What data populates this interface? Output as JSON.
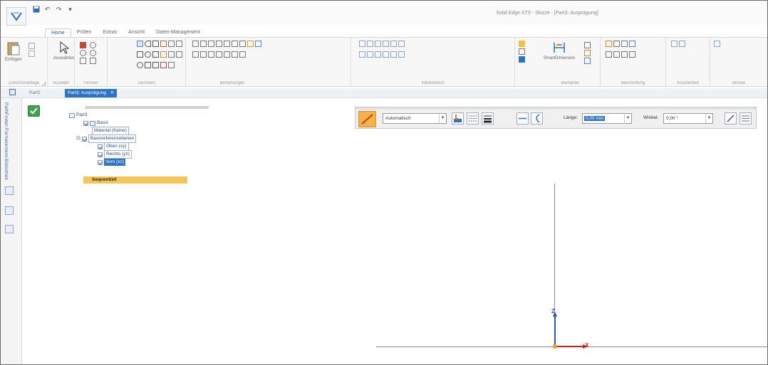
{
  "window": {
    "title": "Solid Edge ST9 - Skizze - [Part3: Ausprägung]"
  },
  "quick_access": {
    "icons": [
      "app-logo-icon",
      "save-icon",
      "undo-icon",
      "redo-icon",
      "customize-icon"
    ]
  },
  "ribbon": {
    "tabs": [
      {
        "label": "Home",
        "active": true
      },
      {
        "label": "Prüfen",
        "active": false
      },
      {
        "label": "Extras",
        "active": false
      },
      {
        "label": "Ansicht",
        "active": false
      },
      {
        "label": "Daten-Management",
        "active": false
      }
    ],
    "groups": {
      "clipboard": {
        "label": "Zwischenablage",
        "paste": "Einfügen"
      },
      "select": {
        "label": "Auswahl",
        "select_button": "Auswählen"
      },
      "view": {
        "label": "Fenster"
      },
      "draw": {
        "label": "Zeichnen"
      },
      "relate": {
        "label": "Beziehungen"
      },
      "intellisketch": {
        "label": "IntelliSketch"
      },
      "dimension": {
        "label": "Bemaßen",
        "smart_dimension": "SmartDimension"
      },
      "annotation": {
        "label": "Beschriftung"
      },
      "assistants": {
        "label": "Assistenten"
      },
      "blocks": {
        "label": "Blöcke"
      }
    }
  },
  "document_tabs": [
    {
      "label": "Part2",
      "active": false
    },
    {
      "label": "Part3: Ausprägung",
      "active": true
    }
  ],
  "sidebar": {
    "vertical_label": "PathFinder-Formelement-Bibliothek"
  },
  "pathfinder": {
    "tree": {
      "root": "Part3",
      "basis": "Basis",
      "material": "Material (Keine)",
      "ref_planes": "Basisreferenzebenen",
      "plane_top": "Oben (xy)",
      "plane_right": "Rechts (yz)",
      "plane_front": "Vorn (xz)",
      "sequential": "Sequentiell"
    }
  },
  "command_bar": {
    "mode": "Automatisch",
    "length_label": "Länge:",
    "length_value": "0,00 mm",
    "angle_label": "Winkel:",
    "angle_value": "0,00 °"
  },
  "canvas": {
    "axis_z": "Z",
    "axis_x": "X"
  },
  "colors": {
    "accent_blue": "#2e74c6",
    "line_tool_orange": "#f6b24a",
    "sequential_yellow": "#f4c55a",
    "accept_green": "#3fa34d"
  }
}
